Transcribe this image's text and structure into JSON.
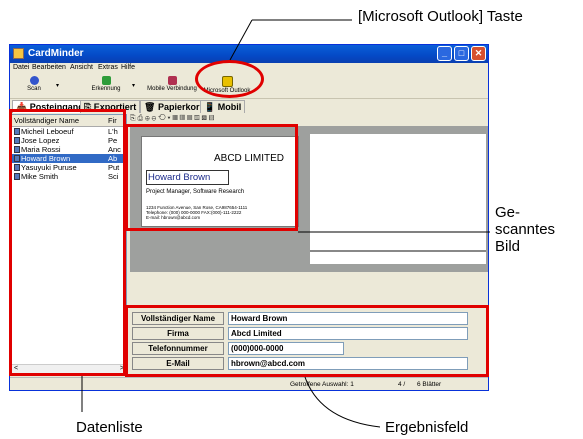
{
  "callouts": {
    "top_label": "[Microsoft Outlook] Taste",
    "right_label_line1": "Ge-",
    "right_label_line2": "scanntes",
    "right_label_line3": "Bild",
    "bottom_left_label": "Datenliste",
    "bottom_right_label": "Ergebnisfeld"
  },
  "window": {
    "title": "CardMinder",
    "minimize_glyph": "_",
    "maximize_glyph": "□",
    "close_glyph": "✕"
  },
  "menu": [
    "Datei",
    "Bearbeiten",
    "Ansicht",
    "Extras",
    "Hilfe"
  ],
  "toolbar": {
    "scan": "Scan",
    "recognition": "Erkennung",
    "mobile_connection": "Mobile Verbindung",
    "outlook": "Microsoft Outlook"
  },
  "tabs": [
    "Posteingang",
    "Exportiert",
    "Papierkorb",
    "Mobil"
  ],
  "list": {
    "headers": [
      "Vollständiger Name",
      "Fir"
    ],
    "rows": [
      {
        "name": "Micheil Leboeuf",
        "firm": "L'h"
      },
      {
        "name": "Jose Lopez",
        "firm": "Pe"
      },
      {
        "name": "Maria Rossi",
        "firm": "Anc"
      },
      {
        "name": "Howard Brown",
        "firm": "Ab"
      },
      {
        "name": "Yasuyuki Puruse",
        "firm": "Put"
      },
      {
        "name": "Mike Smith",
        "firm": "Sci"
      }
    ],
    "selected_index": 3,
    "scroll_left": "<",
    "scroll_right": ">"
  },
  "preview_toolbar_glyphs": "⎘ ⎙ ⊕ ⊖  ⟲ ▾  ▦ ▥ ▤ ▧  ▩ ▨",
  "card": {
    "company": "ABCD LIMITED",
    "name": "Howard Brown",
    "job_title": "Project Manager, Software Research",
    "address_line1": "1234 Function Avenue, San Rose, CA987654-1111",
    "address_line2": "Telephone: (000) 000-0000  FAX:(000)-111-2222",
    "address_line3": "E-mail: hbrown@abcd.com"
  },
  "result_fields": [
    {
      "label": "Vollständiger Name",
      "value": "Howard Brown"
    },
    {
      "label": "Firma",
      "value": "Abcd Limited"
    },
    {
      "label": "Telefonnummer",
      "value": "(000)000-0000"
    },
    {
      "label": "E-Mail",
      "value": "hbrown@abcd.com"
    }
  ],
  "statusbar": {
    "selection": "Getroffene Auswahl: 1",
    "page": "4 /",
    "sheets": "6 Blätter"
  },
  "colors": {
    "highlight_red": "#e00000",
    "titlebar_blue": "#0449c6",
    "selection_blue": "#316ac5"
  }
}
